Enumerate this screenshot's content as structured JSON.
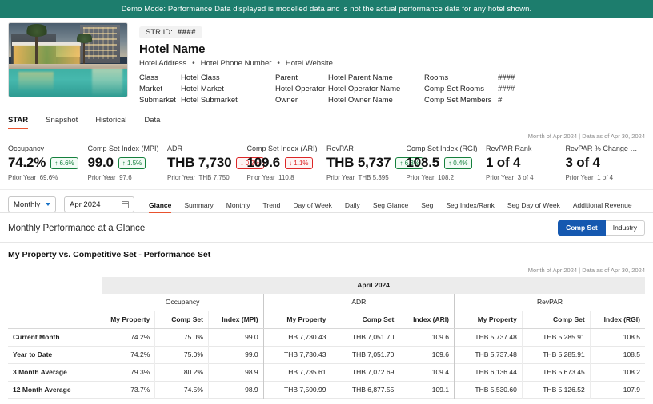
{
  "banner": {
    "text": "Demo Mode: Performance Data displayed is modelled data and is not the actual performance data for any hotel shown."
  },
  "hotel": {
    "str_id_label": "STR ID:",
    "str_id_value": "####",
    "name": "Hotel Name",
    "address": "Hotel Address",
    "phone": "Hotel Phone Number",
    "website": "Hotel Website",
    "attributes": [
      {
        "label": "Class",
        "value": "Hotel Class"
      },
      {
        "label": "Market",
        "value": "Hotel Market"
      },
      {
        "label": "Submarket",
        "value": "Hotel Submarket"
      }
    ],
    "attributes2": [
      {
        "label": "Parent",
        "value": "Hotel Parent Name"
      },
      {
        "label": "Hotel Operator",
        "value": "Hotel Operator Name"
      },
      {
        "label": "Owner",
        "value": "Hotel Owner Name"
      }
    ],
    "attributes3": [
      {
        "label": "Rooms",
        "value": "####"
      },
      {
        "label": "Comp Set Rooms",
        "value": "####"
      },
      {
        "label": "Comp Set Members",
        "value": "#"
      }
    ]
  },
  "tabs": {
    "items": [
      "STAR",
      "Snapshot",
      "Historical",
      "Data"
    ],
    "active": "STAR"
  },
  "kpi": {
    "asof": "Month of Apr 2024 | Data as of Apr 30, 2024",
    "prior_label": "Prior Year",
    "items": [
      {
        "label": "Occupancy",
        "value": "74.2%",
        "delta": "6.6%",
        "dir": "up",
        "prior": "69.6%"
      },
      {
        "label": "Comp Set Index (MPI)",
        "value": "99.0",
        "delta": "1.5%",
        "dir": "up",
        "prior": "97.6"
      },
      {
        "label": "ADR",
        "value": "THB 7,730",
        "delta": "0.2%",
        "dir": "down",
        "prior": "THB 7,750"
      },
      {
        "label": "Comp Set Index (ARI)",
        "value": "109.6",
        "delta": "1.1%",
        "dir": "down",
        "prior": "110.8"
      },
      {
        "label": "RevPAR",
        "value": "THB 5,737",
        "delta": "6.3%",
        "dir": "up",
        "prior": "THB 5,395"
      },
      {
        "label": "Comp Set Index (RGI)",
        "value": "108.5",
        "delta": "0.4%",
        "dir": "up",
        "prior": "108.2"
      },
      {
        "label": "RevPAR Rank",
        "value": "1 of 4",
        "delta": "",
        "dir": "none",
        "prior": "3 of 4"
      },
      {
        "label": "RevPAR % Change …",
        "value": "3 of 4",
        "delta": "",
        "dir": "none",
        "prior": "1 of 4"
      }
    ]
  },
  "controls": {
    "frequency": "Monthly",
    "period": "Apr 2024",
    "subtabs": [
      "Glance",
      "Summary",
      "Monthly",
      "Trend",
      "Day of Week",
      "Daily",
      "Seg Glance",
      "Seg",
      "Seg Index/Rank",
      "Seg Day of Week",
      "Additional Revenue"
    ],
    "active_subtab": "Glance"
  },
  "glance": {
    "title": "Monthly Performance at a Glance",
    "toggle": [
      "Comp Set",
      "Industry"
    ],
    "toggle_active": "Comp Set"
  },
  "perf": {
    "title": "My Property vs. Competitive Set - Performance Set",
    "asof": "Month of Apr 2024 | Data as of Apr 30, 2024",
    "period_header": "April 2024",
    "groups": [
      "Occupancy",
      "ADR",
      "RevPAR"
    ],
    "subheaders": {
      "occupancy": [
        "My Property",
        "Comp Set",
        "Index (MPI)"
      ],
      "adr": [
        "My Property",
        "Comp Set",
        "Index (ARI)"
      ],
      "revpar": [
        "My Property",
        "Comp Set",
        "Index (RGI)"
      ]
    },
    "rows": [
      {
        "label": "Current Month",
        "occ_mine": "74.2%",
        "occ_comp": "75.0%",
        "occ_idx": "99.0",
        "adr_mine": "THB 7,730.43",
        "adr_comp": "THB 7,051.70",
        "adr_idx": "109.6",
        "rev_mine": "THB 5,737.48",
        "rev_comp": "THB 5,285.91",
        "rev_idx": "108.5"
      },
      {
        "label": "Year to Date",
        "occ_mine": "74.2%",
        "occ_comp": "75.0%",
        "occ_idx": "99.0",
        "adr_mine": "THB 7,730.43",
        "adr_comp": "THB 7,051.70",
        "adr_idx": "109.6",
        "rev_mine": "THB 5,737.48",
        "rev_comp": "THB 5,285.91",
        "rev_idx": "108.5"
      },
      {
        "label": "3 Month Average",
        "occ_mine": "79.3%",
        "occ_comp": "80.2%",
        "occ_idx": "98.9",
        "adr_mine": "THB 7,735.61",
        "adr_comp": "THB 7,072.69",
        "adr_idx": "109.4",
        "rev_mine": "THB 6,136.44",
        "rev_comp": "THB 5,673.45",
        "rev_idx": "108.2"
      },
      {
        "label": "12 Month Average",
        "occ_mine": "73.7%",
        "occ_comp": "74.5%",
        "occ_idx": "98.9",
        "adr_mine": "THB 7,500.99",
        "adr_comp": "THB 6,877.55",
        "adr_idx": "109.1",
        "rev_mine": "THB 5,530.60",
        "rev_comp": "THB 5,126.52",
        "rev_idx": "107.9"
      }
    ]
  },
  "colors": {
    "banner_green": "#1d7d6d",
    "accent_orange": "#e8522e",
    "toggle_blue": "#1558b0",
    "up_green": "#15803d",
    "down_red": "#dc2626"
  }
}
